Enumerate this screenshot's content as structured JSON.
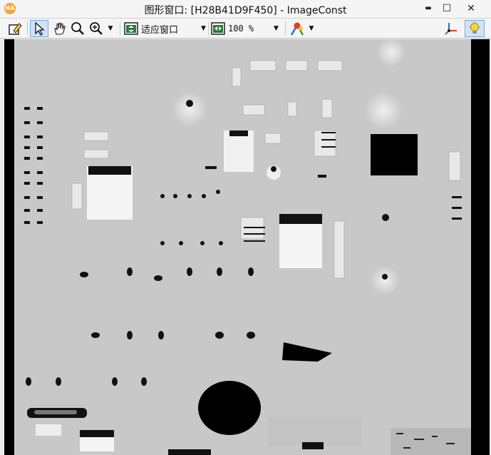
{
  "window": {
    "title": "图形窗口: [H28B41D9F450] - ImageConst",
    "app_icon_text": "HA",
    "minimize_glyph": "▬",
    "maximize_glyph": "☐",
    "close_glyph": "✕"
  },
  "toolbar": {
    "fit_label": "适应窗口",
    "zoom_label": "100 %",
    "caret": "▼"
  },
  "image": {
    "background": "#000000",
    "board_color": "#c9c9c9"
  }
}
